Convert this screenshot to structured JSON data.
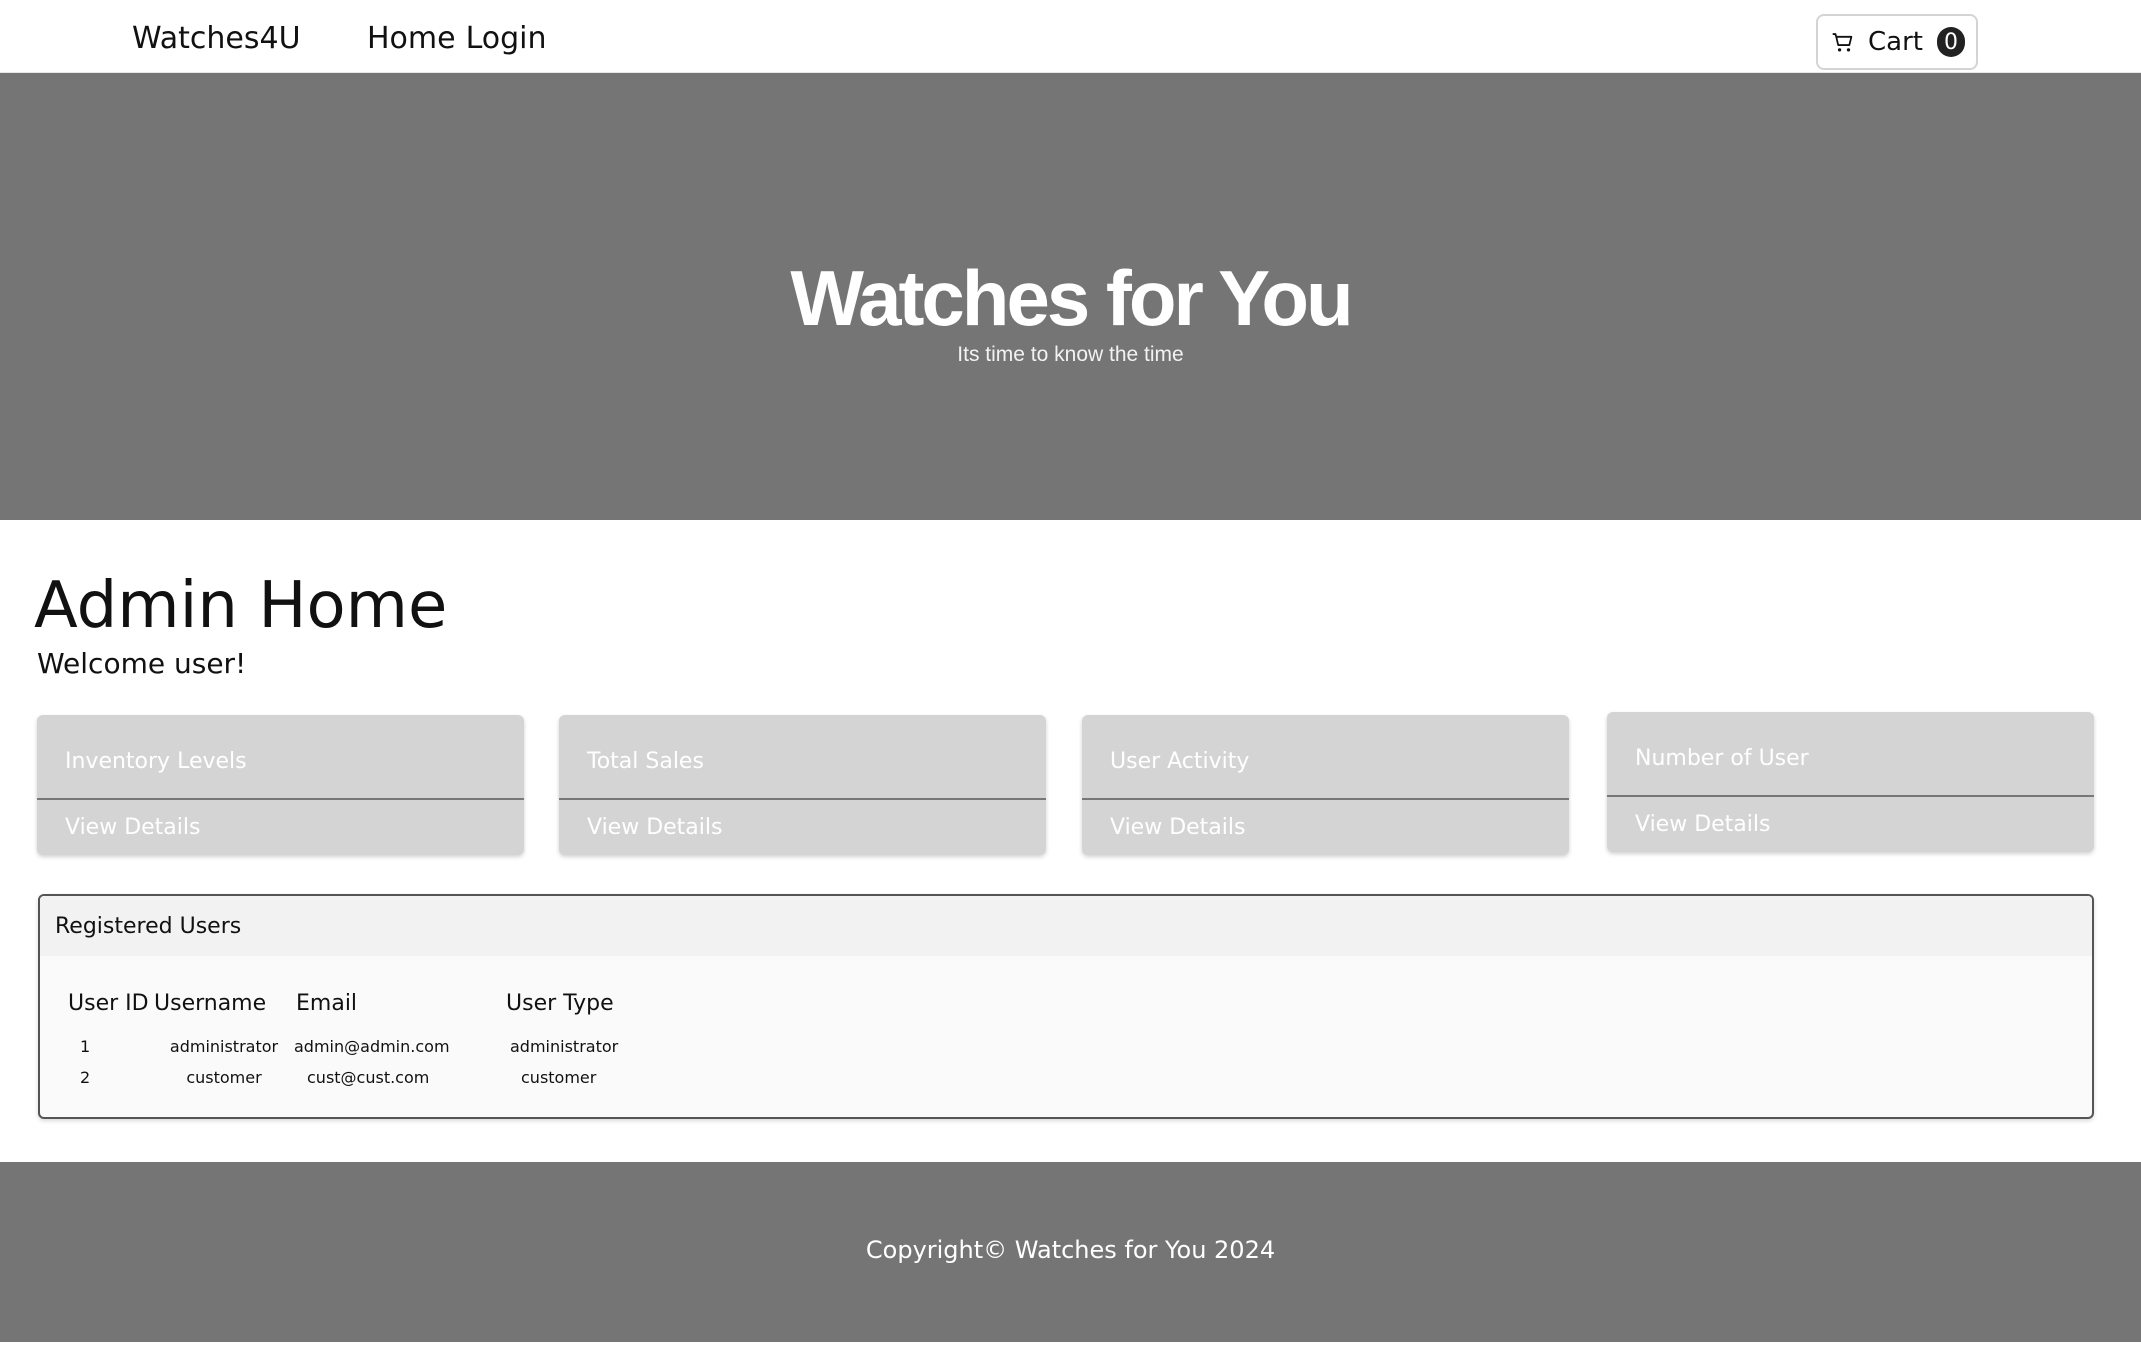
{
  "navbar": {
    "brand": "Watches4U",
    "links": [
      "Home",
      "Login"
    ],
    "cart": {
      "label": "Cart",
      "count": "0",
      "icon": "cart-icon"
    }
  },
  "hero": {
    "title": "Watches for You",
    "subtitle": "Its time to know the time"
  },
  "admin": {
    "title": "Admin Home",
    "welcome": "Welcome user!"
  },
  "cards": [
    {
      "title": "Inventory Levels",
      "link": "View Details"
    },
    {
      "title": "Total Sales",
      "link": "View Details"
    },
    {
      "title": "User Activity",
      "link": "View Details"
    },
    {
      "title": "Number of User",
      "link": "View Details"
    }
  ],
  "users_panel": {
    "title": "Registered Users",
    "columns": [
      "User ID",
      "Username",
      "Email",
      "User Type"
    ],
    "rows": [
      [
        "1",
        "administrator",
        "admin@admin.com",
        "administrator"
      ],
      [
        "2",
        "customer",
        "cust@cust.com",
        "customer"
      ]
    ]
  },
  "footer": {
    "text": "Copyright© Watches for You 2024"
  },
  "colors": {
    "hero_bg": "#757575",
    "card_bg": "#d4d4d4",
    "footer_bg": "#757575"
  }
}
